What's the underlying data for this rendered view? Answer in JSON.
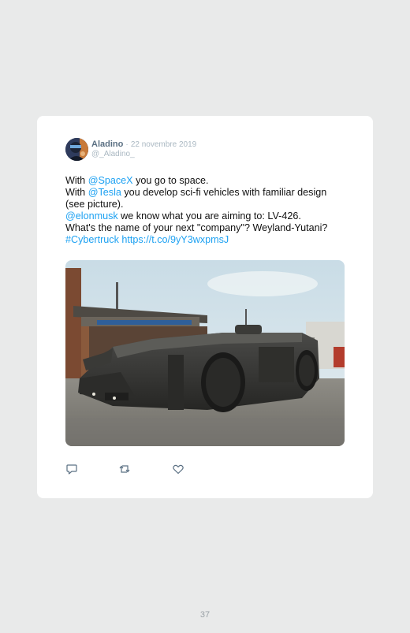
{
  "tweet": {
    "author": {
      "name": "Aladino",
      "handle": "@_Aladino_"
    },
    "date_separator": "·",
    "date": "22 novembre 2019",
    "lines": {
      "l1": {
        "pre": "With ",
        "mention": "@SpaceX",
        "post": " you go to space."
      },
      "l2": {
        "pre": "With ",
        "mention": "@Tesla",
        "post": " you develop sci-fi vehicles with familiar design"
      },
      "l3": {
        "text": "(see picture)."
      },
      "l4": {
        "mention": "@elonmusk",
        "post": " we know what you are aiming to: LV-426."
      },
      "l5": {
        "text": "What's the name of your next \"company\"? Weyland-Yutani?"
      },
      "l6": {
        "hashtag": "#Cybertruck",
        "space": " ",
        "url": "https://t.co/9yY3wxpmsJ"
      }
    },
    "actions": {
      "reply": "reply-icon",
      "retweet": "retweet-icon",
      "like": "heart-icon"
    }
  },
  "page": {
    "number": "37"
  },
  "colors": {
    "page_background": "#e9eaea",
    "card_background": "#ffffff",
    "link": "#1da1f2",
    "author_name": "#5b7083",
    "secondary_text": "#aab8c2"
  }
}
